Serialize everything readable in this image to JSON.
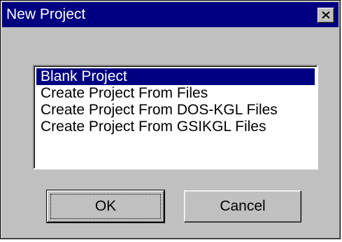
{
  "window": {
    "title": "New Project",
    "close_icon": "close-x-icon"
  },
  "list": {
    "items": [
      {
        "label": "Blank Project",
        "selected": true
      },
      {
        "label": "Create Project From Files",
        "selected": false
      },
      {
        "label": "Create Project From DOS-KGL Files",
        "selected": false
      },
      {
        "label": "Create Project From GSIKGL Files",
        "selected": false
      }
    ]
  },
  "buttons": {
    "ok_label": "OK",
    "cancel_label": "Cancel"
  },
  "colors": {
    "titlebar": "#000080",
    "selection": "#000080",
    "face": "#c0c0c0"
  }
}
